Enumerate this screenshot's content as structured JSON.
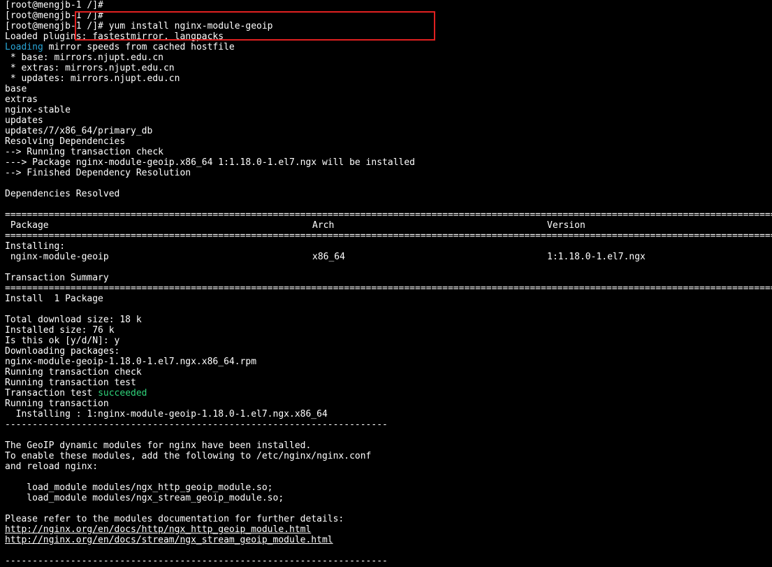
{
  "terminal": {
    "lines": {
      "l00": "[root@mengjb-1 /]#",
      "l01": "[root@mengjb-1 /]#",
      "l02": "[root@mengjb-1 /]# yum install nginx-module-geoip",
      "l03": "Loaded plugins: fastestmirror, langpacks",
      "l04_a": "Loading",
      "l04_b": " mirror speeds from cached hostfile",
      "l05": " * base: mirrors.njupt.edu.cn",
      "l06": " * extras: mirrors.njupt.edu.cn",
      "l07": " * updates: mirrors.njupt.edu.cn",
      "l08": "base",
      "l09": "extras",
      "l10": "nginx-stable",
      "l11": "updates",
      "l12": "updates/7/x86_64/primary_db",
      "l13": "Resolving Dependencies",
      "l14": "--> Running transaction check",
      "l15": "---> Package nginx-module-geoip.x86_64 1:1.18.0-1.el7.ngx will be installed",
      "l16": "--> Finished Dependency Resolution",
      "l17": "",
      "l18": "Dependencies Resolved",
      "l19": "",
      "rule_eq": "==========================================================================================================================================================================",
      "table_header": {
        "package": " Package",
        "arch": "Arch",
        "version": "Version"
      },
      "l23": "Installing:",
      "table_row": {
        "package": " nginx-module-geoip",
        "arch": "x86_64",
        "version": "1:1.18.0-1.el7.ngx"
      },
      "l25": "",
      "l26": "Transaction Summary",
      "l28": "Install  1 Package",
      "l29": "",
      "l30": "Total download size: 18 k",
      "l31": "Installed size: 76 k",
      "l32": "Is this ok [y/d/N]: y",
      "l33": "Downloading packages:",
      "l34": "nginx-module-geoip-1.18.0-1.el7.ngx.x86_64.rpm",
      "l35": "Running transaction check",
      "l36": "Running transaction test",
      "l37_a": "Transaction test ",
      "l37_b": "succeeded",
      "l38": "Running transaction",
      "l39": "  Installing : 1:nginx-module-geoip-1.18.0-1.el7.ngx.x86_64",
      "rule_dash": "----------------------------------------------------------------------",
      "l41": "",
      "l42": "The GeoIP dynamic modules for nginx have been installed.",
      "l43": "To enable these modules, add the following to /etc/nginx/nginx.conf",
      "l44": "and reload nginx:",
      "l45": "",
      "l46": "    load_module modules/ngx_http_geoip_module.so;",
      "l47": "    load_module modules/ngx_stream_geoip_module.so;",
      "l48": "",
      "l49": "Please refer to the modules documentation for further details:",
      "l50": "http://nginx.org/en/docs/http/ngx_http_geoip_module.html",
      "l51": "http://nginx.org/en/docs/stream/ngx_stream_geoip_module.html",
      "l52": ""
    },
    "colors": {
      "background": "#000000",
      "foreground": "#ffffff",
      "loading_accent": "#29a7d8",
      "success_accent": "#2fd37a",
      "highlight_border": "#e02020"
    }
  }
}
